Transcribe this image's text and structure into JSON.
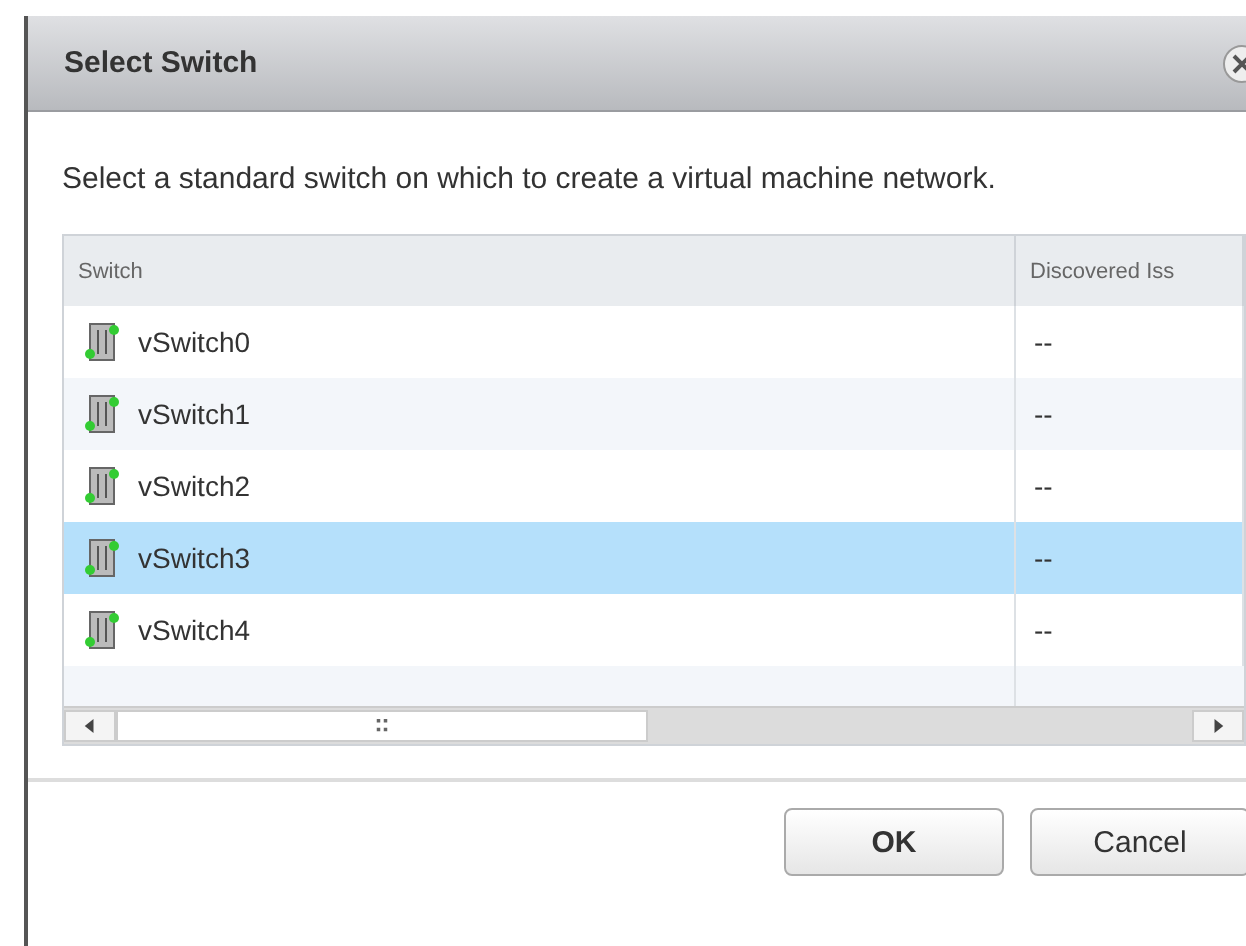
{
  "dialog": {
    "title": "Select Switch",
    "description": "Select a standard switch on which to create a virtual machine network."
  },
  "table": {
    "columns": [
      "Switch",
      "Discovered Iss"
    ],
    "rows": [
      {
        "name": "vSwitch0",
        "issues": "--",
        "selected": false
      },
      {
        "name": "vSwitch1",
        "issues": "--",
        "selected": false
      },
      {
        "name": "vSwitch2",
        "issues": "--",
        "selected": false
      },
      {
        "name": "vSwitch3",
        "issues": "--",
        "selected": true
      },
      {
        "name": "vSwitch4",
        "issues": "--",
        "selected": false
      }
    ]
  },
  "buttons": [
    "OK",
    "Cancel"
  ]
}
